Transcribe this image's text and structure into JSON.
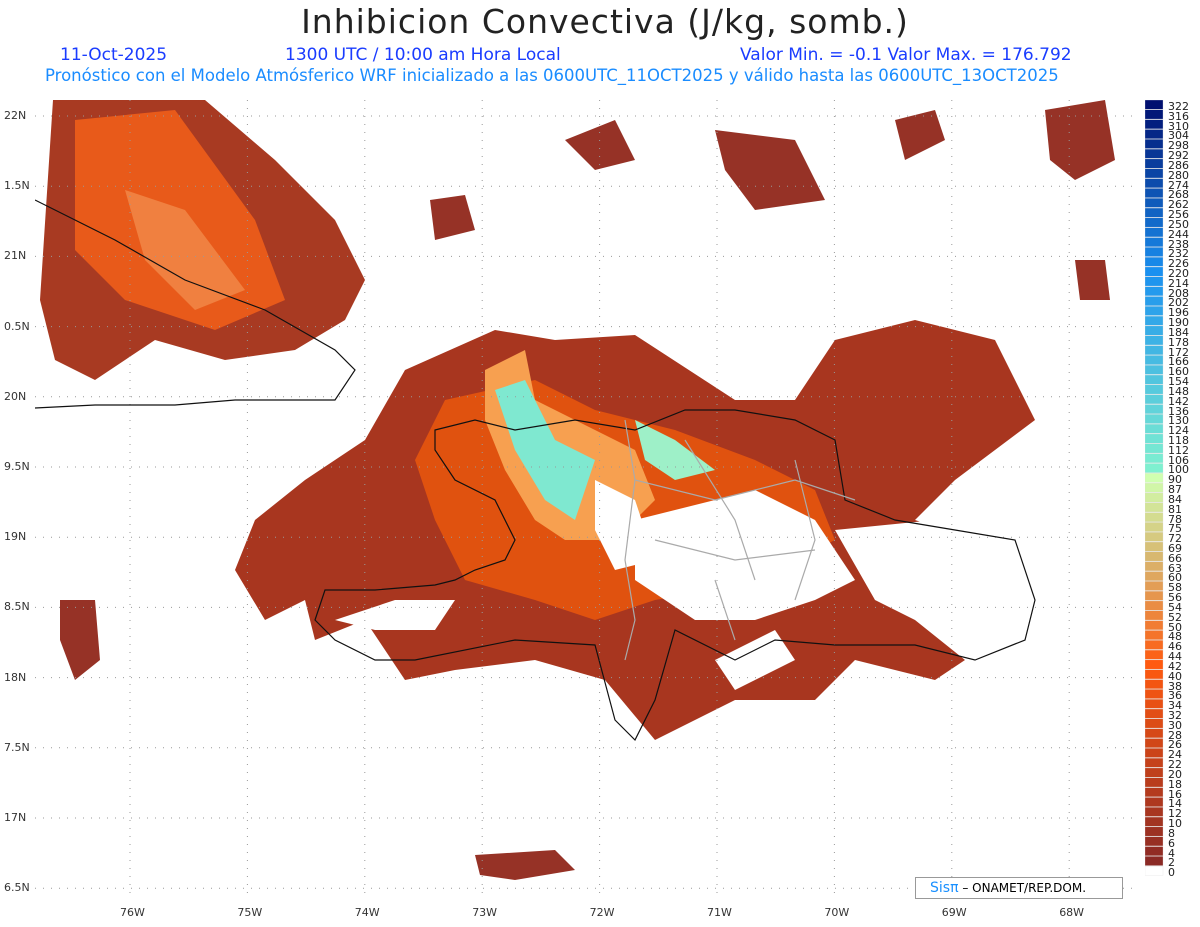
{
  "header": {
    "title": "Inhibicion Convectiva (J/kg, somb.)",
    "date": "11-Oct-2025",
    "time": "1300 UTC / 10:00 am Hora Local",
    "minmax": "Valor Min. = -0.1  Valor Max. = 176.792",
    "forecast": "Pronóstico con el Modelo Atmósferico WRF inicializado a las 0600UTC_11OCT2025 y válido hasta las  0600UTC_13OCT2025"
  },
  "axes": {
    "lat_labels": [
      "22N",
      "1.5N",
      "21N",
      "0.5N",
      "20N",
      "9.5N",
      "19N",
      "8.5N",
      "18N",
      "7.5N",
      "17N",
      "6.5N"
    ],
    "lon_labels": [
      "76W",
      "75W",
      "74W",
      "73W",
      "72W",
      "71W",
      "70W",
      "69W",
      "68W"
    ]
  },
  "colorbar": {
    "labels": [
      "322",
      "316",
      "310",
      "304",
      "298",
      "292",
      "286",
      "280",
      "274",
      "268",
      "262",
      "256",
      "250",
      "244",
      "238",
      "232",
      "226",
      "220",
      "214",
      "208",
      "202",
      "196",
      "190",
      "184",
      "178",
      "172",
      "166",
      "160",
      "154",
      "148",
      "142",
      "136",
      "130",
      "124",
      "118",
      "112",
      "106",
      "100",
      "90",
      "87",
      "84",
      "81",
      "78",
      "75",
      "72",
      "69",
      "66",
      "63",
      "60",
      "58",
      "56",
      "54",
      "52",
      "50",
      "48",
      "46",
      "44",
      "42",
      "40",
      "38",
      "36",
      "34",
      "32",
      "30",
      "28",
      "26",
      "24",
      "22",
      "20",
      "18",
      "16",
      "14",
      "12",
      "10",
      "8",
      "6",
      "4",
      "2",
      "0"
    ],
    "colors": {
      "high": "#001070",
      "mid_blue": "#1a90f0",
      "cyan": "#7ff0d0",
      "pale": "#d0ffb0",
      "tan": "#d8b870",
      "orange": "#ff5a10",
      "brown": "#8b2a25",
      "zero": "#ffffff"
    }
  },
  "credit": {
    "logo": "Sisπ",
    "sep": " – ",
    "org": "ONAMET/REP.DOM."
  }
}
